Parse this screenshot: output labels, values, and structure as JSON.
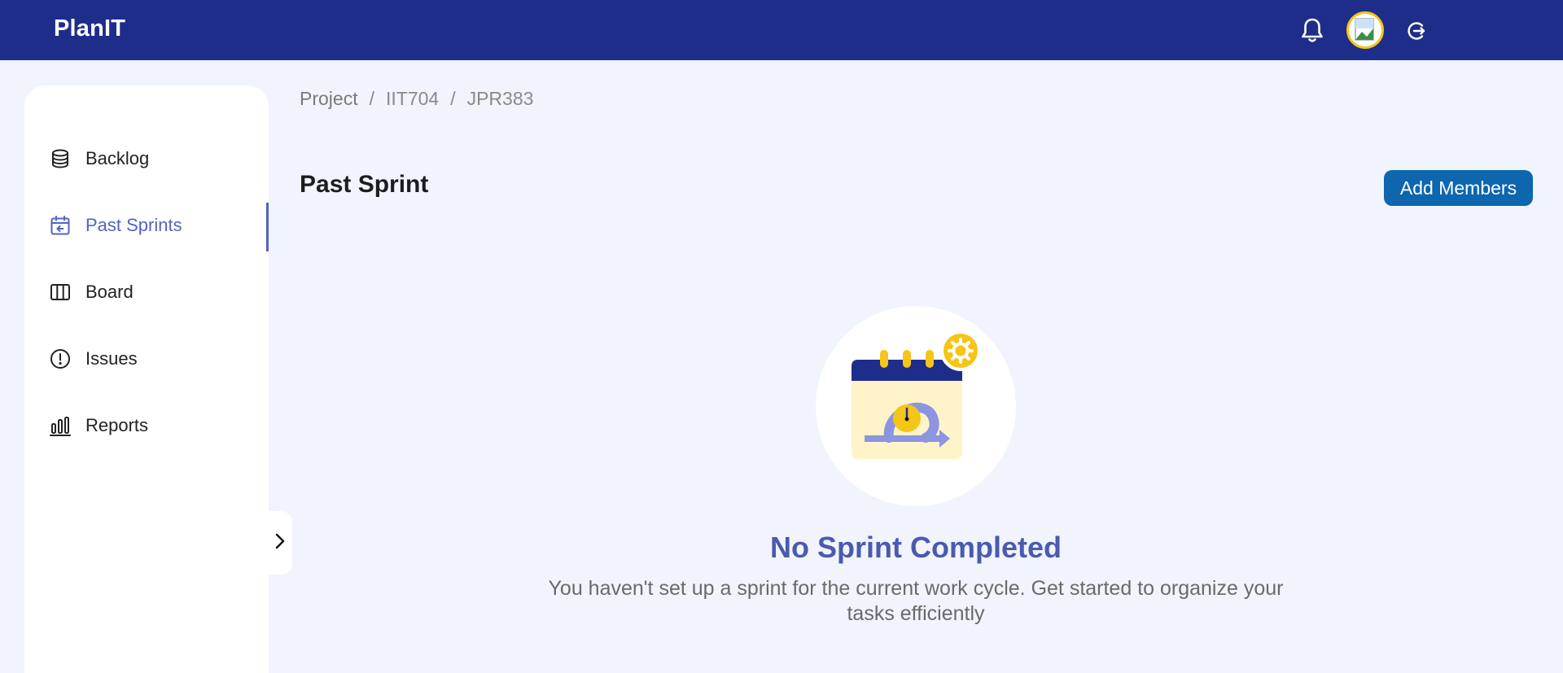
{
  "app": {
    "title": "PlanIT"
  },
  "header": {
    "icons": [
      "bell-icon",
      "avatar",
      "logout-icon"
    ],
    "colors": {
      "bar": "#1f2d8a",
      "avatar_ring": "#f5c518"
    }
  },
  "sidebar": {
    "items": [
      {
        "label": "Backlog",
        "icon": "database-icon",
        "active": false
      },
      {
        "label": "Past Sprints",
        "icon": "calendar-back-icon",
        "active": true
      },
      {
        "label": "Board",
        "icon": "columns-icon",
        "active": false
      },
      {
        "label": "Issues",
        "icon": "alert-circle-icon",
        "active": false
      },
      {
        "label": "Reports",
        "icon": "bar-chart-icon",
        "active": false
      }
    ],
    "active_color": "#5563c1"
  },
  "breadcrumb": [
    "Project",
    "IIT704",
    "JPR383"
  ],
  "main": {
    "title": "Past Sprint",
    "add_members_label": "Add Members",
    "empty_state": {
      "title": "No Sprint Completed",
      "description": "You haven't set up a sprint for the current work cycle. Get started to organize your tasks efficiently",
      "illustration": "sprint-calendar-icon"
    }
  }
}
